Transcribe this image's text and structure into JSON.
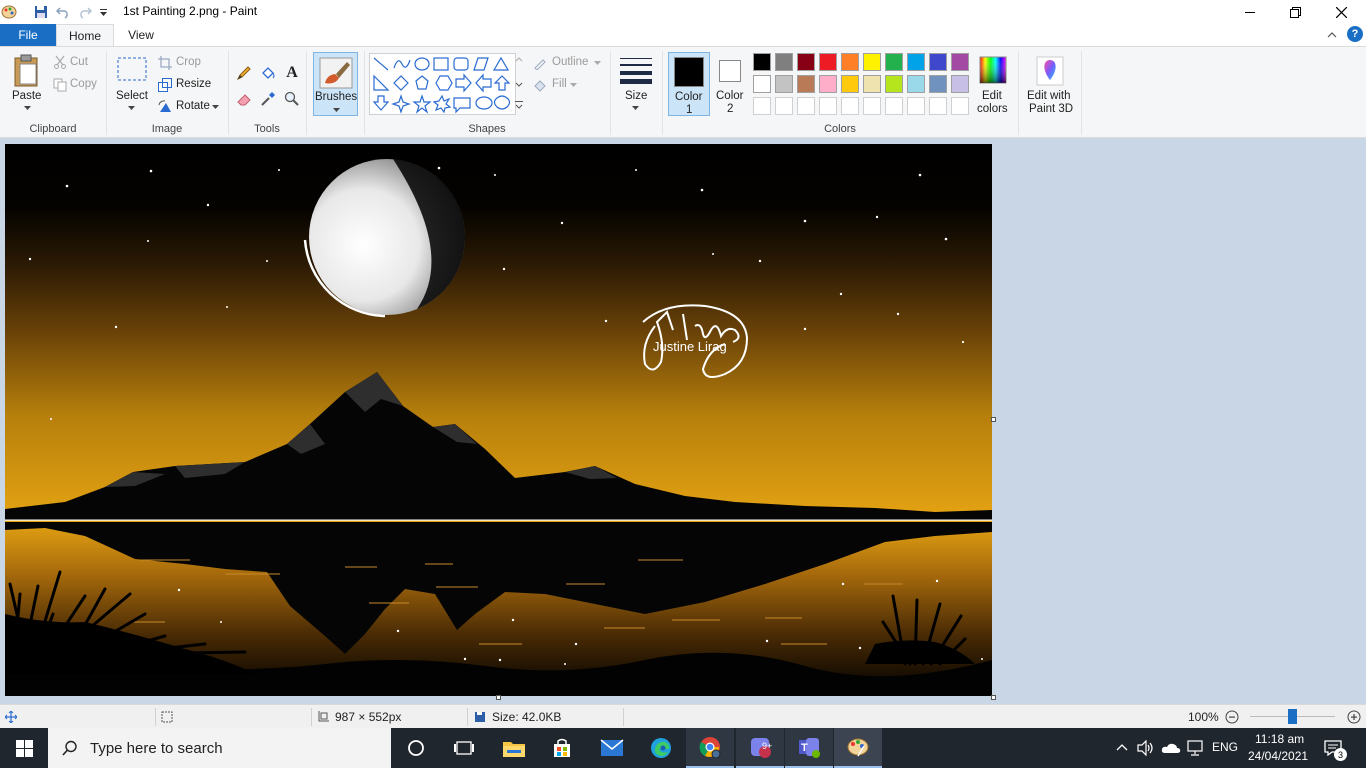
{
  "window": {
    "title": "1st Painting 2.png - Paint"
  },
  "tabs": [
    {
      "label": "File"
    },
    {
      "label": "Home"
    },
    {
      "label": "View"
    }
  ],
  "clipboard": {
    "paste": "Paste",
    "cut": "Cut",
    "copy": "Copy",
    "group": "Clipboard"
  },
  "image": {
    "select": "Select",
    "crop": "Crop",
    "resize": "Resize",
    "rotate": "Rotate",
    "group": "Image"
  },
  "tools": {
    "group": "Tools"
  },
  "brushes": {
    "label": "Brushes"
  },
  "shapes": {
    "outline": "Outline",
    "fill": "Fill",
    "group": "Shapes"
  },
  "size": {
    "label": "Size"
  },
  "colors": {
    "color1": "Color",
    "color1_num": "1",
    "color2": "Color",
    "color2_num": "2",
    "edit_line1": "Edit",
    "edit_line2": "colors",
    "group": "Colors",
    "palette_row1": [
      "#000000",
      "#7f7f7f",
      "#880015",
      "#ed1c24",
      "#ff7f27",
      "#fff200",
      "#22b14c",
      "#00a2e8",
      "#3f48cc",
      "#a349a4"
    ],
    "palette_row2": [
      "#ffffff",
      "#c3c3c3",
      "#b97a57",
      "#ffaec9",
      "#ffc90e",
      "#efe4b0",
      "#b5e61d",
      "#99d9ea",
      "#7092be",
      "#c8bfe7"
    ],
    "color1_value": "#000000",
    "color2_value": "#ffffff"
  },
  "paint3d": {
    "line1": "Edit with",
    "line2": "Paint 3D"
  },
  "canvas": {
    "signature_text": "Justine Lirag"
  },
  "status": {
    "dimensions": "987 × 552px",
    "size": "Size: 42.0KB",
    "zoom": "100%"
  },
  "taskbar": {
    "search_placeholder": "Type here to search",
    "language": "ENG",
    "time": "11:18 am",
    "date": "24/04/2021",
    "notifications": "3",
    "teams_badge": "9+"
  }
}
